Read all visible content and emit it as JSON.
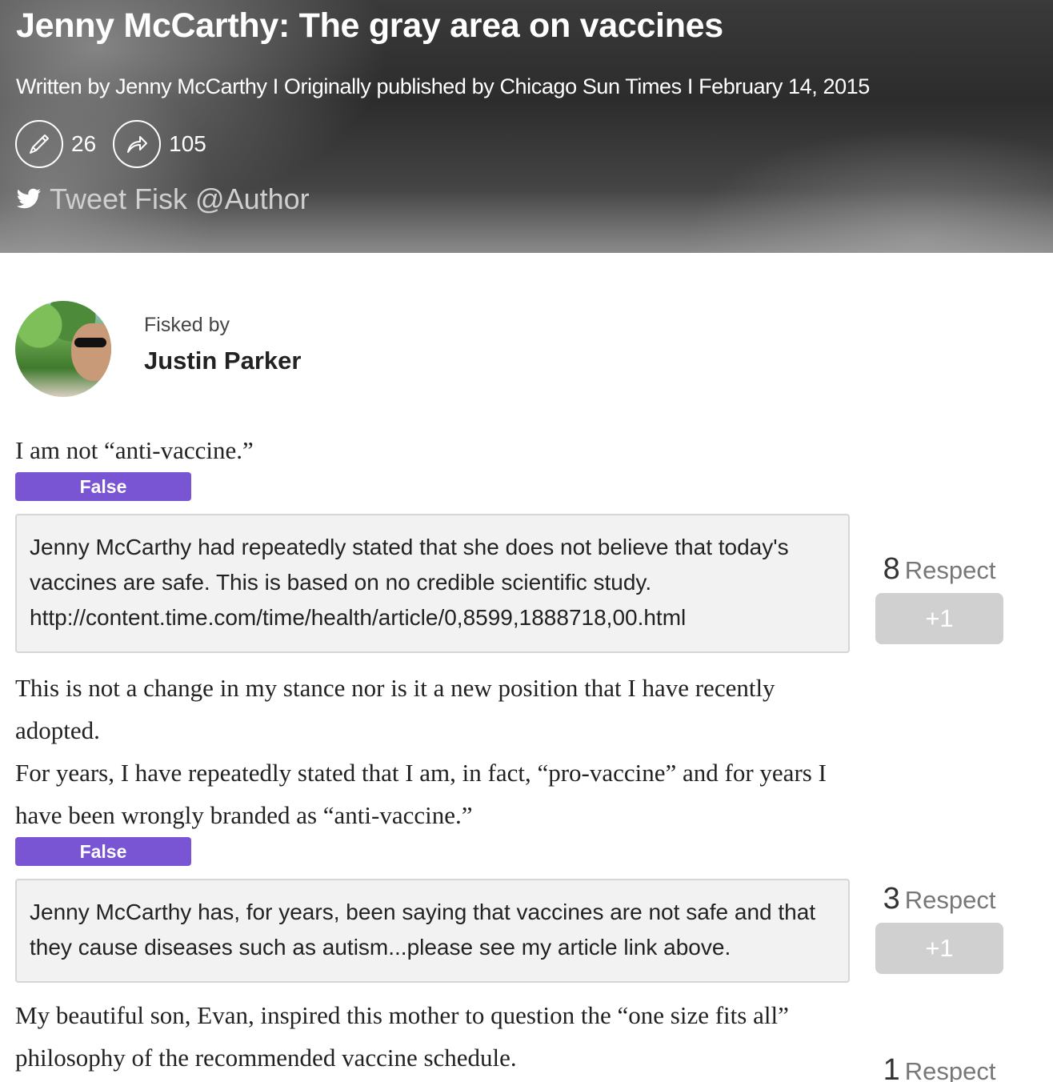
{
  "header": {
    "title": "Jenny McCarthy: The gray area on vaccines",
    "byline": "Written by Jenny McCarthy I Originally published by Chicago Sun Times I February 14, 2015",
    "comments_count": "26",
    "shares_count": "105",
    "tweet_label": "Tweet Fisk @Author",
    "icons": {
      "comments": "pencil-icon",
      "shares": "share-icon",
      "tweet": "twitter-bird-icon"
    }
  },
  "fisker": {
    "label": "Fisked by",
    "name": "Justin Parker"
  },
  "items": [
    {
      "quote": "I am not “anti-vaccine.”",
      "badge": "False",
      "response": "Jenny McCarthy had repeatedly stated that she does not believe that today's vaccines are safe. This is based on no credible scientific study. http://content.time.com/time/health/article/0,8599,1888718,00.html",
      "respect_count": "8",
      "respect_label": "Respect",
      "plus_label": "+1"
    },
    {
      "quote": "This is not a change in my stance nor is it a new position that I have recently adopted.",
      "quote2": "For years, I have repeatedly stated that I am, in fact, “pro-vaccine” and for years I have been wrongly branded as “anti-vaccine.”",
      "badge": "False",
      "response": "Jenny McCarthy has, for years, been saying that vaccines are not safe and that they cause diseases such as autism...please see my article link above.",
      "respect_count": "3",
      "respect_label": "Respect",
      "plus_label": "+1"
    },
    {
      "quote": "My beautiful son, Evan, inspired this mother to question the “one size fits all” philosophy of the recommended vaccine schedule.",
      "respect_count": "1",
      "respect_label": "Respect"
    }
  ],
  "colors": {
    "badge": "#7a55d3",
    "plus_button": "#d0d0d0",
    "response_bg": "#f2f2f2"
  }
}
